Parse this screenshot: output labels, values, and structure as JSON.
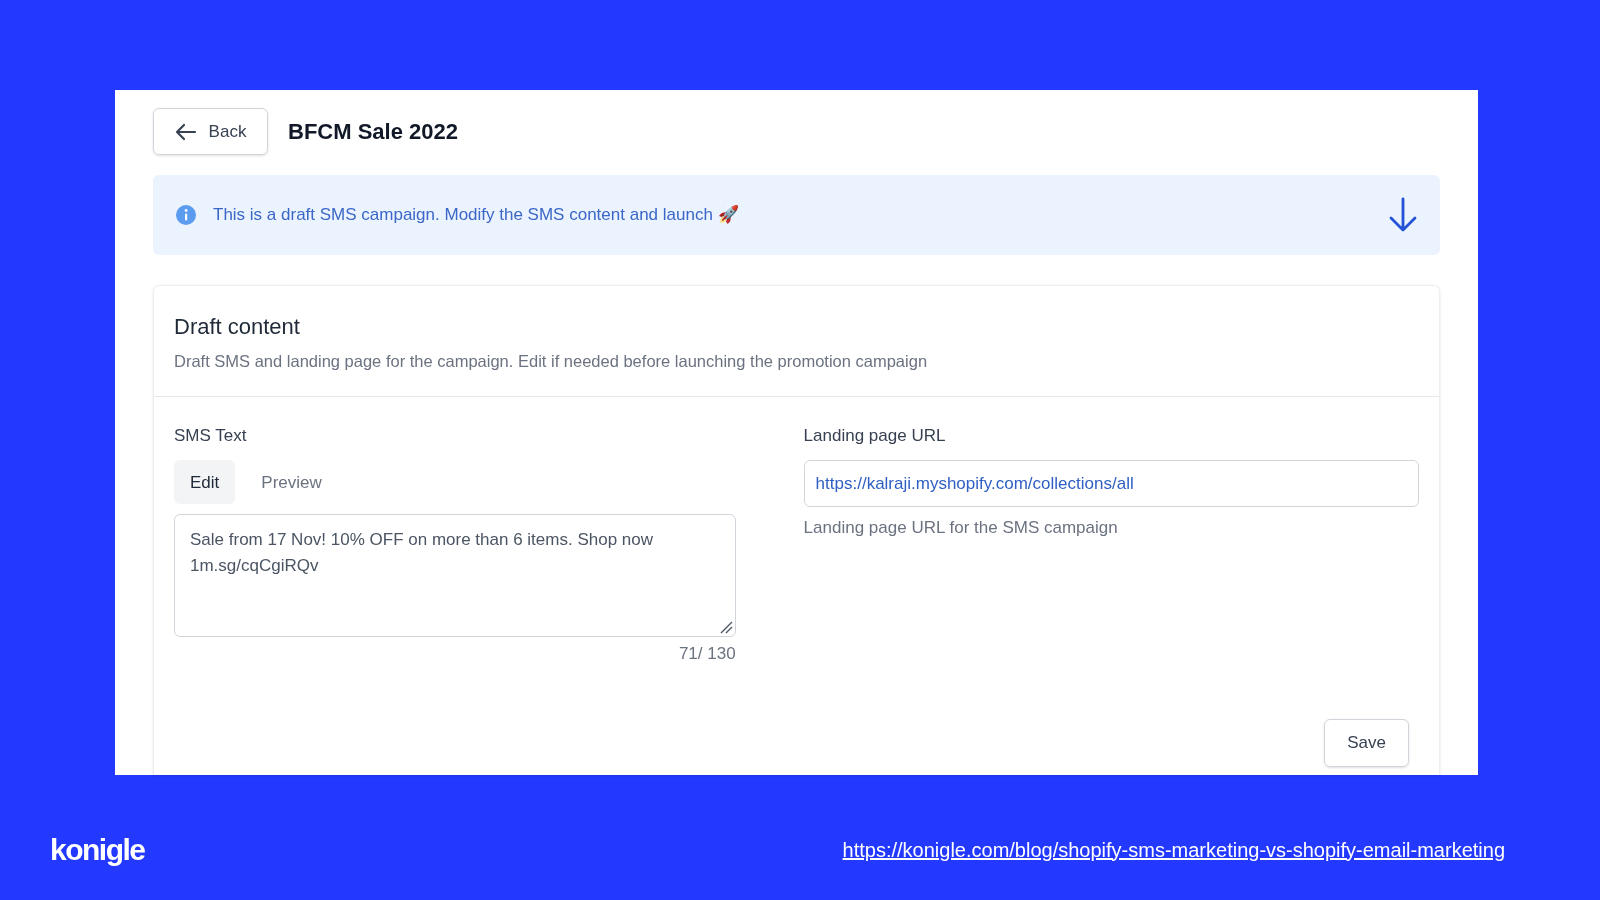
{
  "header": {
    "back_button": "Back",
    "title": "BFCM Sale 2022"
  },
  "alert": {
    "text": "This is a draft SMS campaign. Modify the SMS content and launch 🚀"
  },
  "card": {
    "title": "Draft content",
    "description": "Draft SMS and landing page for the campaign. Edit if needed before launching the promotion campaign"
  },
  "sms": {
    "label": "SMS Text",
    "tabs": [
      {
        "label": "Edit",
        "selected": true
      },
      {
        "label": "Preview",
        "selected": false
      }
    ],
    "value": "Sale from 17 Nov! 10% OFF on more than 6 items. Shop now 1m.sg/cqCgiRQv",
    "counter": "71/ 130"
  },
  "landing": {
    "label": "Landing page URL",
    "value": "https://kalraji.myshopify.com/collections/all",
    "help": "Landing page URL for the SMS campaign"
  },
  "save_button": "Save",
  "footer": {
    "logo": "konigle",
    "link": "https://konigle.com/blog/shopify-sms-marketing-vs-shopify-email-marketing"
  }
}
